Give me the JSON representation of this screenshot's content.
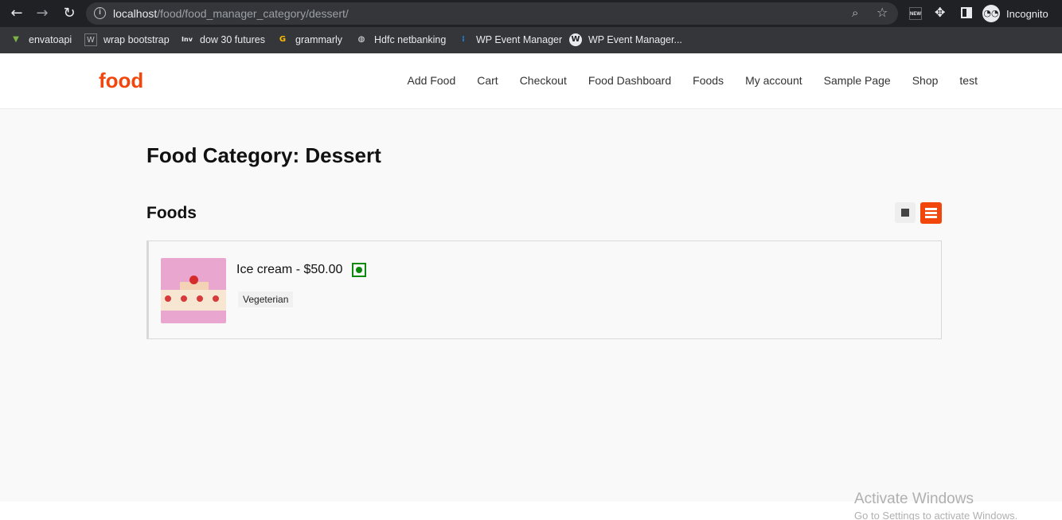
{
  "browser": {
    "url_host": "localhost",
    "url_path": "/food/food_manager_category/dessert/",
    "profile_label": "Incognito",
    "ext_badge": "NEW",
    "icons": {
      "back": "back-arrow-icon",
      "forward": "forward-arrow-icon",
      "reload": "reload-icon",
      "zoom": "zoom-icon",
      "star": "bookmark-star-icon"
    }
  },
  "bookmarks": [
    {
      "label": "envatoapi",
      "icon": "envato-icon",
      "glyph": "▼",
      "color": "#7cb342"
    },
    {
      "label": "wrap bootstrap",
      "icon": "wrapbootstrap-icon",
      "glyph": "W",
      "color": "#bdbdbd"
    },
    {
      "label": "dow 30 futures",
      "icon": "investing-icon",
      "glyph": "Inv",
      "color": "#e8eaed"
    },
    {
      "label": "grammarly",
      "icon": "google-icon",
      "glyph": "G",
      "color": "#fbbc05"
    },
    {
      "label": "Hdfc netbanking",
      "icon": "globe-icon",
      "glyph": "◍",
      "color": "#e8eaed"
    },
    {
      "label": "WP Event Manager",
      "icon": "wp-event-manager-icon",
      "glyph": "⁞",
      "color": "#1e88e5"
    },
    {
      "label": "WP Event Manager...",
      "icon": "wordpress-icon",
      "glyph": "W",
      "color": "#e8eaed"
    }
  ],
  "site": {
    "logo": "food",
    "brand_color": "#f2470c",
    "nav": [
      "Add Food",
      "Cart",
      "Checkout",
      "Food Dashboard",
      "Foods",
      "My account",
      "Sample Page",
      "Shop",
      "test"
    ]
  },
  "main": {
    "page_title": "Food Category: Dessert",
    "section_title": "Foods",
    "foods": [
      {
        "name_price": "Ice cream - $50.00",
        "tag": "Vegeterian",
        "veg_color": "#0b8a0b"
      }
    ]
  },
  "watermark": {
    "title": "Activate Windows",
    "subtitle": "Go to Settings to activate Windows."
  }
}
